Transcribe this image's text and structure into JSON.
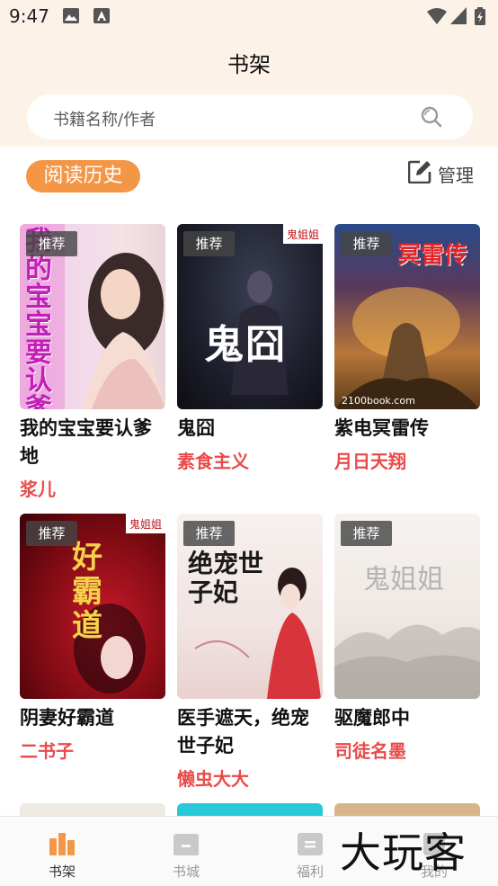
{
  "status_bar": {
    "time": "9:47"
  },
  "header": {
    "title": "书架",
    "search_placeholder": "书籍名称/作者"
  },
  "section": {
    "history_label": "阅读历史",
    "manage_label": "管理"
  },
  "books": [
    {
      "tag": "推荐",
      "title": "我的宝宝要认爹地",
      "author": "浆儿",
      "cover_text": "我的宝宝要认爹地"
    },
    {
      "tag": "推荐",
      "title": "鬼囧",
      "author": "素食主义",
      "cover_text": "鬼囧"
    },
    {
      "tag": "推荐",
      "title": "紫电冥雷传",
      "author": "月日天翔",
      "cover_text": "冥雷传"
    },
    {
      "tag": "推荐",
      "title": "阴妻好霸道",
      "author": "二书子",
      "cover_text": "好霸道"
    },
    {
      "tag": "推荐",
      "title": "医手遮天，绝宠世子妃",
      "author": "懒虫大大",
      "cover_text": "绝宠世子妃"
    },
    {
      "tag": "推荐",
      "title": "驱魔郎中",
      "author": "司徒名墨",
      "cover_text": "鬼姐姐"
    }
  ],
  "bottom_nav": [
    {
      "label": "书架",
      "icon": "bookshelf-icon",
      "active": true
    },
    {
      "label": "书城",
      "icon": "bookstore-icon",
      "active": false
    },
    {
      "label": "福利",
      "icon": "welfare-icon",
      "active": false
    },
    {
      "label": "我的",
      "icon": "profile-icon",
      "active": false
    }
  ],
  "watermark": "大玩客",
  "colors": {
    "accent": "#f39646",
    "author": "#ea4a4a",
    "header_bg": "#fdf2e8"
  }
}
